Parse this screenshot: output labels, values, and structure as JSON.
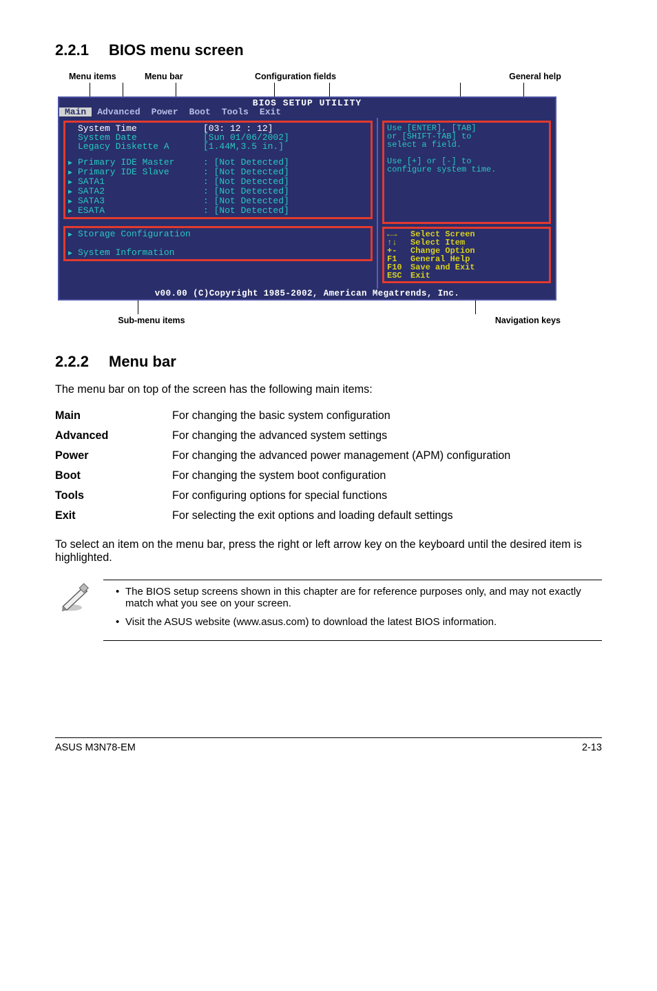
{
  "sec1": {
    "num": "2.2.1",
    "title": "BIOS menu screen"
  },
  "labels": {
    "menuitems": "Menu items",
    "menubar": "Menu bar",
    "config": "Configuration fields",
    "general": "General help",
    "submenu": "Sub-menu items",
    "nav": "Navigation keys"
  },
  "bios": {
    "title": "BIOS SETUP UTILITY",
    "menu": [
      "Main",
      "Advanced",
      "Power",
      "Boot",
      "Tools",
      "Exit"
    ],
    "rows1": [
      {
        "l": "System Time",
        "r": "[03: 12 : 12]",
        "cls": "notri"
      },
      {
        "l": "System Date",
        "r": "[Sun 01/06/2002]",
        "cls": "notri"
      },
      {
        "l": "Legacy Diskette A",
        "r": "[1.44M,3.5 in.]",
        "cls": "notri"
      }
    ],
    "rows2": [
      {
        "l": "Primary IDE Master",
        "r": ": [Not Detected]",
        "cls": "tri"
      },
      {
        "l": "Primary IDE Slave",
        "r": ": [Not Detected]",
        "cls": "tri"
      },
      {
        "l": "SATA1",
        "r": ": [Not Detected]",
        "cls": "tri"
      },
      {
        "l": "SATA2",
        "r": ": [Not Detected]",
        "cls": "tri"
      },
      {
        "l": "SATA3",
        "r": ": [Not Detected]",
        "cls": "tri"
      },
      {
        "l": "ESATA",
        "r": ": [Not Detected]",
        "cls": "tri"
      }
    ],
    "rows3": [
      {
        "l": "Storage Configuration",
        "cls": "tri"
      },
      {
        "l": "",
        "cls": "notri"
      },
      {
        "l": "System Information",
        "cls": "tri"
      }
    ],
    "help_top": [
      "Use [ENTER], [TAB]",
      "or [SHIFT-TAB] to",
      "select a field.",
      "",
      "Use [+] or [-] to",
      "configure system time."
    ],
    "help_bottom": [
      {
        "k": "←→",
        "v": "Select Screen"
      },
      {
        "k": "↑↓",
        "v": "Select Item"
      },
      {
        "k": "+-",
        "v": "Change Option"
      },
      {
        "k": "F1",
        "v": "General Help"
      },
      {
        "k": "F10",
        "v": "Save and Exit"
      },
      {
        "k": "ESC",
        "v": "Exit"
      }
    ],
    "footer": "v00.00 (C)Copyright 1985-2002, American Megatrends, Inc."
  },
  "sec2": {
    "num": "2.2.2",
    "title": "Menu bar"
  },
  "intro": "The menu bar on top of the screen has the following main items:",
  "defs": [
    {
      "k": "Main",
      "v": "For changing the basic system configuration"
    },
    {
      "k": "Advanced",
      "v": "For changing the advanced system settings"
    },
    {
      "k": "Power",
      "v": "For changing the advanced power management (APM) configuration"
    },
    {
      "k": "Boot",
      "v": "For changing the system boot configuration"
    },
    {
      "k": "Tools",
      "v": "For configuring options for special functions"
    },
    {
      "k": "Exit",
      "v": "For selecting the exit options and loading default settings"
    }
  ],
  "para": "To select an item on the menu bar, press the right or left arrow key on the keyboard until the desired item is highlighted.",
  "notes": [
    "The BIOS setup screens shown in this chapter are for reference purposes only, and may not exactly match what you see on your screen.",
    "Visit the ASUS website (www.asus.com) to download the latest BIOS information."
  ],
  "footer": {
    "left": "ASUS M3N78-EM",
    "right": "2-13"
  }
}
